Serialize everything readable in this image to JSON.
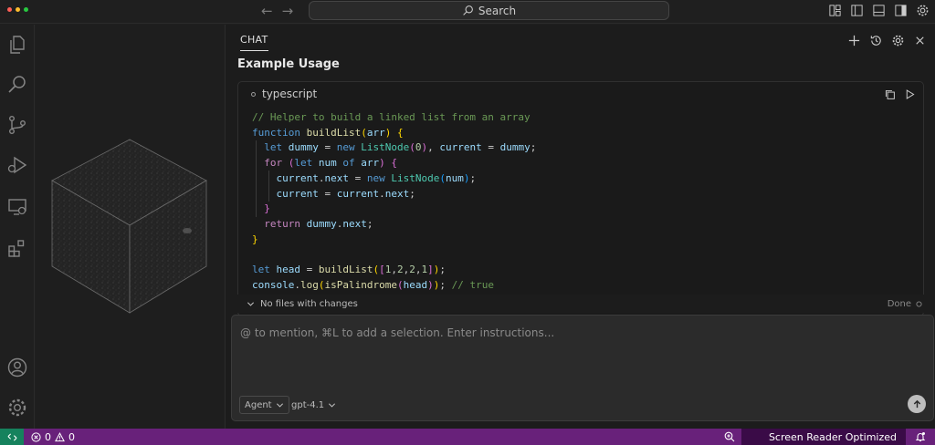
{
  "titlebar": {
    "search_label": "Search",
    "icons": [
      "arrow-left-icon",
      "arrow-right-icon",
      "search-icon",
      "layout-icon",
      "toggle-sidebar-icon",
      "toggle-panel-icon",
      "toggle-secondary-sidebar-icon",
      "gear-icon"
    ]
  },
  "activitybar": {
    "items": [
      "explorer-icon",
      "search-icon",
      "source-control-icon",
      "run-debug-icon",
      "remote-explorer-icon",
      "extensions-icon"
    ],
    "bottom": [
      "account-icon",
      "manage-gear-icon"
    ]
  },
  "chat": {
    "tab_label": "CHAT",
    "actions": [
      "plus-icon",
      "history-icon",
      "gear-icon",
      "close-icon"
    ],
    "heading": "Example Usage",
    "code_language": "typescript",
    "code_actions": [
      "copy-icon",
      "run-icon"
    ],
    "no_files_label": "No files with changes",
    "done_label": "Done",
    "input_placeholder": "@ to mention, ⌘L to add a selection. Enter instructions...",
    "mode_label": "Agent",
    "model_label": "gpt-4.1"
  },
  "statusbar": {
    "errors": "0",
    "warnings": "0",
    "screen_reader_label": "Screen Reader Optimized"
  },
  "colors": {
    "statusbar": "#68217a",
    "remote": "#16825d",
    "screen_reader_bg": "#3a0b47"
  }
}
